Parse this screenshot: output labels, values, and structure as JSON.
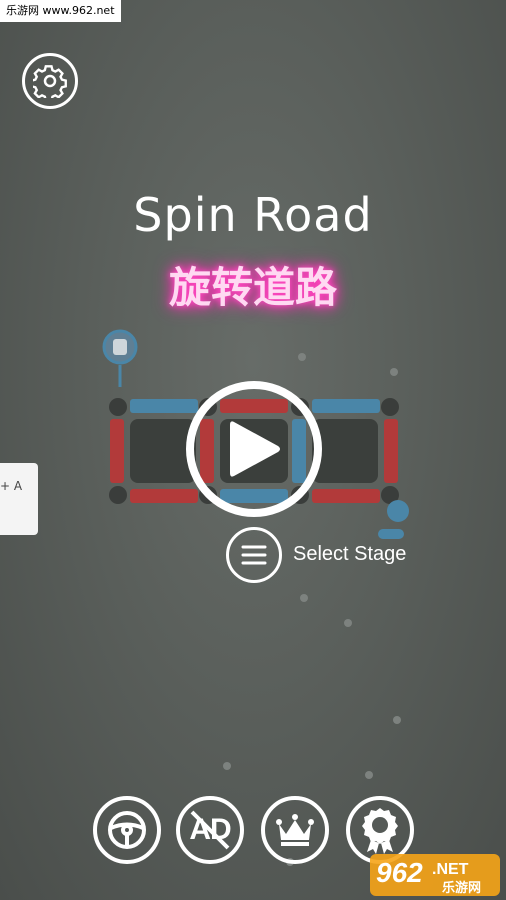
{
  "watermark_top": "乐游网 www.962.net",
  "title": "Spin Road",
  "subtitle_cn": "旋转道路",
  "side_panel_text": "+ A",
  "select_stage_label": "Select Stage",
  "watermark_logo": {
    "number": "962",
    "suffix": ".NET",
    "cn": "乐游网"
  },
  "icons": {
    "settings": "gear-icon",
    "play": "play-icon",
    "select": "menu-icon",
    "steering": "steering-wheel-icon",
    "no_ads": "no-ads-icon",
    "leaderboard": "crown-icon",
    "achievements": "award-badge-icon"
  },
  "no_ads_text": "AD",
  "colors": {
    "track_red": "#b23a3a",
    "track_blue": "#4a86a8",
    "glow_pink": "#ff2fb5"
  }
}
